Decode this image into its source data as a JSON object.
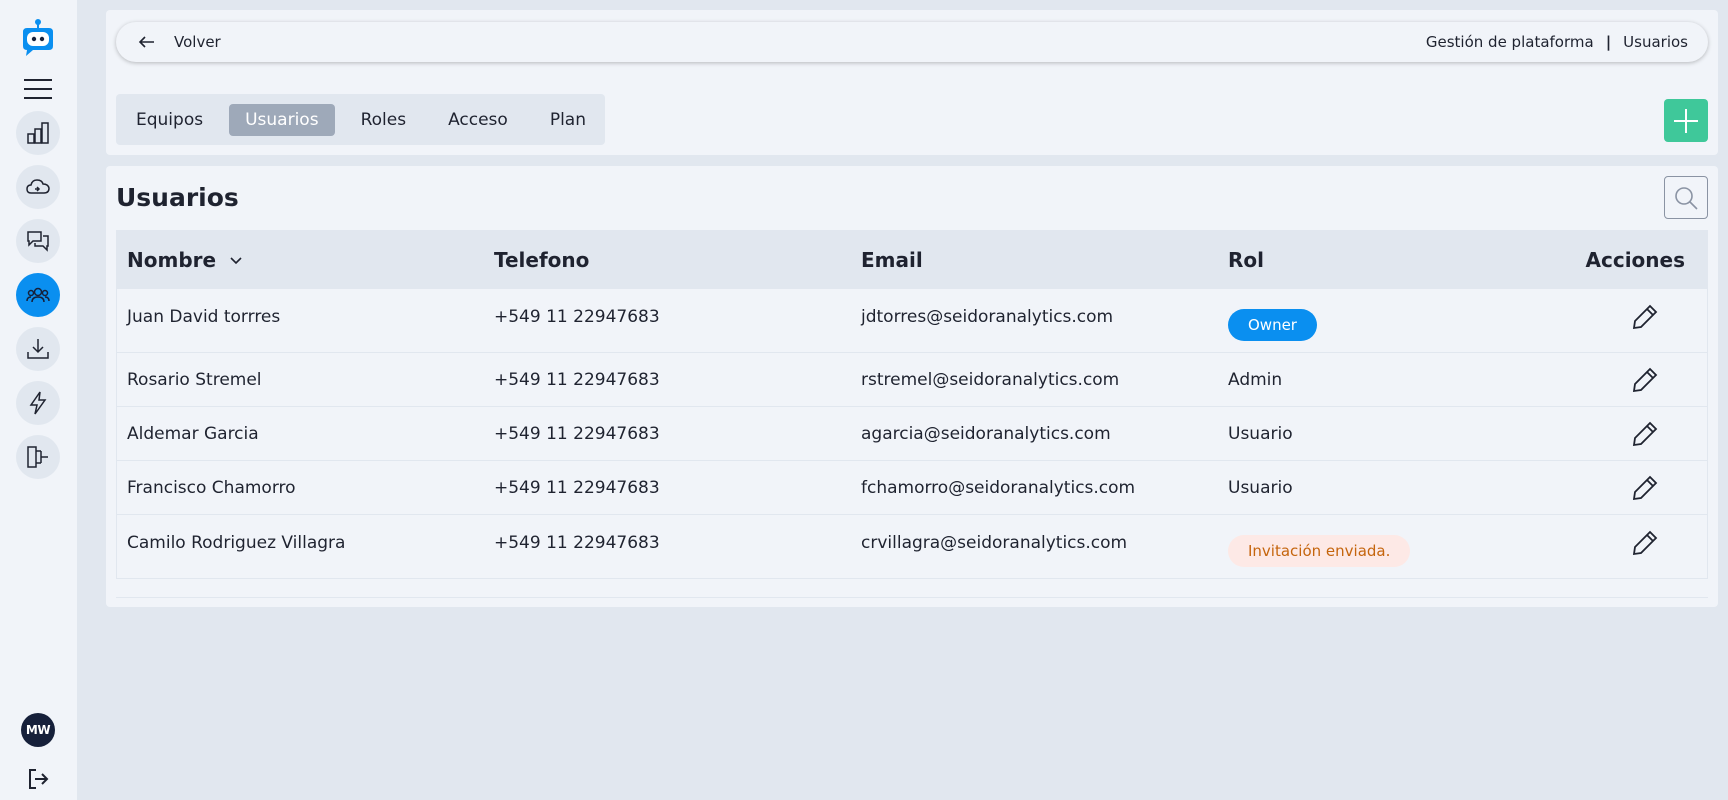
{
  "header": {
    "back_label": "Volver",
    "breadcrumb": [
      "Gestión de plataforma",
      "Usuarios"
    ],
    "breadcrumb_separator": "|"
  },
  "tabs": [
    {
      "label": "Equipos",
      "active": false
    },
    {
      "label": "Usuarios",
      "active": true
    },
    {
      "label": "Roles",
      "active": false
    },
    {
      "label": "Acceso",
      "active": false
    },
    {
      "label": "Plan",
      "active": false
    }
  ],
  "sidebar": {
    "items": [
      "logo-icon",
      "menu-icon",
      "chart-icon",
      "cloud-icon",
      "chat-icon",
      "users-icon",
      "download-icon",
      "lightning-icon",
      "flow-icon"
    ],
    "avatar_initials": "MW"
  },
  "main": {
    "title": "Usuarios",
    "columns": [
      "Nombre",
      "Telefono",
      "Email",
      "Rol",
      "Acciones"
    ],
    "rows": [
      {
        "name": "Juan David torrres",
        "phone": "+549 11 22947683",
        "email": "jdtorres@seidoranalytics.com",
        "role": "Owner"
      },
      {
        "name": "Rosario Stremel",
        "phone": "+549 11 22947683",
        "email": "rstremel@seidoranalytics.com",
        "role": "Admin"
      },
      {
        "name": "Aldemar Garcia",
        "phone": "+549 11 22947683",
        "email": "agarcia@seidoranalytics.com",
        "role": "Usuario"
      },
      {
        "name": "Francisco Chamorro",
        "phone": "+549 11 22947683",
        "email": "fchamorro@seidoranalytics.com",
        "role": "Usuario"
      },
      {
        "name": "Camilo Rodriguez Villagra",
        "phone": "+549 11 22947683",
        "email": "crvillagra@seidoranalytics.com",
        "role": "Invitación enviada."
      }
    ]
  },
  "colors": {
    "accent": "#0a8ff0",
    "add_button": "#3fc89a",
    "owner_badge": "#0a8ff0",
    "invite_badge_bg": "#fde9e6",
    "invite_badge_text": "#c5650d"
  }
}
